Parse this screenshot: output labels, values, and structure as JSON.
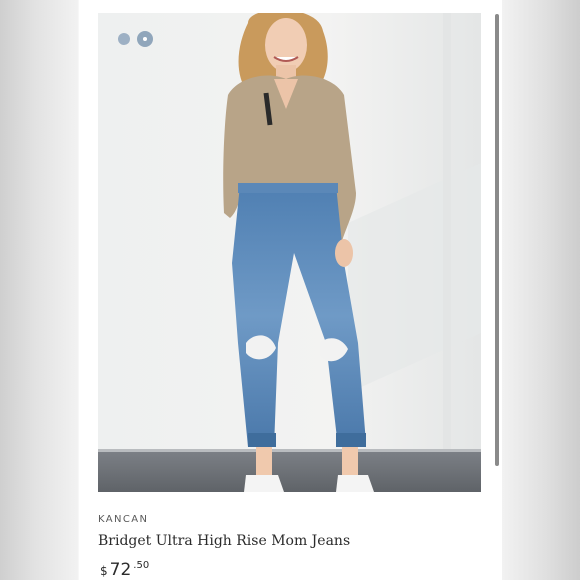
{
  "product": {
    "brand": "KANCAN",
    "title": "Bridget Ultra High Rise Mom Jeans",
    "price": {
      "currency": "$",
      "whole": "72",
      "cents": ".50"
    }
  },
  "carousel": {
    "slide_count": 2,
    "active_index": 1
  },
  "colors": {
    "dot": "#90a6bb",
    "text": "#2b2b2b"
  }
}
